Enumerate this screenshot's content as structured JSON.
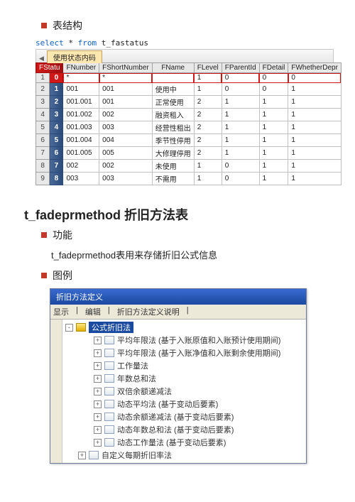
{
  "sec1_label": "表结构",
  "sql": {
    "select": "select",
    "star": "*",
    "from": "from",
    "table": "t_fastatus"
  },
  "tab_label": "使用状态内码",
  "grid": {
    "corner": "FStatu",
    "headers": [
      "",
      "",
      "FNumber",
      "FShortNumber",
      "FName",
      "FLevel",
      "FParentId",
      "FDetail",
      "FWhetherDepr"
    ],
    "rows": [
      {
        "n": "1",
        "g": "0",
        "c": [
          "*",
          "*",
          "",
          "1",
          "0",
          "0",
          "0"
        ],
        "hl": true
      },
      {
        "n": "2",
        "g": "1",
        "c": [
          "001",
          "001",
          "使用中",
          "1",
          "0",
          "0",
          "1"
        ]
      },
      {
        "n": "3",
        "g": "2",
        "c": [
          "001.001",
          "001",
          "正常使用",
          "2",
          "1",
          "1",
          "1"
        ]
      },
      {
        "n": "4",
        "g": "3",
        "c": [
          "001.002",
          "002",
          "融资租入",
          "2",
          "1",
          "1",
          "1"
        ]
      },
      {
        "n": "5",
        "g": "4",
        "c": [
          "001.003",
          "003",
          "经营性租出",
          "2",
          "1",
          "1",
          "1"
        ]
      },
      {
        "n": "6",
        "g": "5",
        "c": [
          "001.004",
          "004",
          "季节性停用",
          "2",
          "1",
          "1",
          "1"
        ]
      },
      {
        "n": "7",
        "g": "6",
        "c": [
          "001.005",
          "005",
          "大修理停用",
          "2",
          "1",
          "1",
          "1"
        ]
      },
      {
        "n": "8",
        "g": "7",
        "c": [
          "002",
          "002",
          "未使用",
          "1",
          "0",
          "1",
          "1"
        ]
      },
      {
        "n": "9",
        "g": "8",
        "c": [
          "003",
          "003",
          "不需用",
          "1",
          "0",
          "1",
          "1"
        ]
      }
    ]
  },
  "section2_title": "t_fadeprmethod  折旧方法表",
  "sec2a_label": "功能",
  "sec2a_text": "t_fadeprmethod表用来存储折旧公式信息",
  "sec2b_label": "图例",
  "win": {
    "title": "折旧方法定义",
    "menus": [
      "显示",
      "编辑",
      "折旧方法定义说明"
    ],
    "root_open": "公式折旧法",
    "children": [
      "平均年限法 (基于入账原值和入账预计使用期间)",
      "平均年限法 (基于入账净值和入账剩余使用期间)",
      "工作量法",
      "年数总和法",
      "双倍余额递减法",
      "动态平均法 (基于变动后要素)",
      "动态余额递减法 (基于变动后要素)",
      "动态年数总和法 (基于变动后要素)",
      "动态工作量法 (基于变动后要素)"
    ],
    "sibling": "自定义每期折旧率法"
  }
}
